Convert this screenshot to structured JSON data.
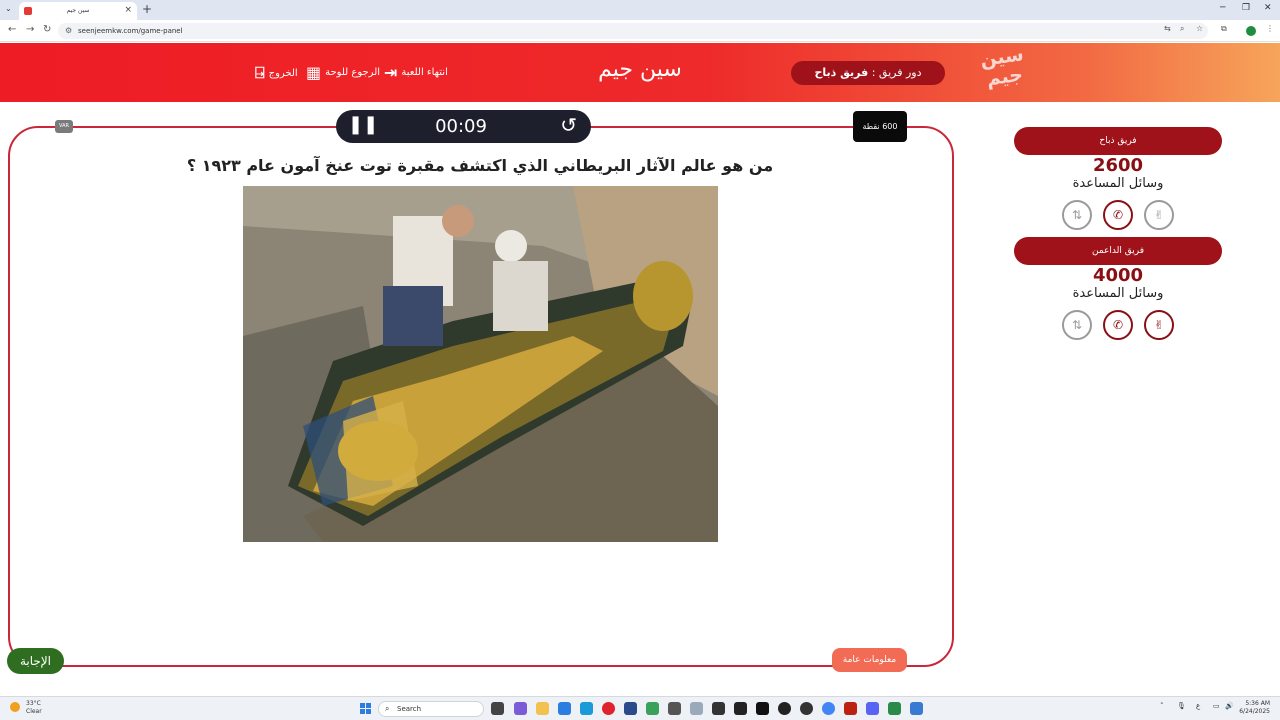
{
  "browser": {
    "tab_title": "سين جيم",
    "url": "seenjeemkw.com/game-panel",
    "new_tab": "+",
    "tab_close": "×",
    "minimize": "─",
    "restore": "❐",
    "close": "✕"
  },
  "header": {
    "app_title": "سين جيم",
    "logo_text_top": "سين",
    "logo_text_bottom": "جيم",
    "turn_prefix": "دور فريق : ",
    "turn_team": "فريق ذباح",
    "links": {
      "end_game": "انتهاء اللعبة",
      "back_board": "الرجوع للوحة",
      "exit": "الخروج"
    }
  },
  "question": {
    "timer": "00:09",
    "points": "600 نقطة",
    "text": "من هو عالم الآثار البريطاني الذي اكتشف مقبرة توت عنخ آمون عام ١٩٢٣ ؟",
    "category": "معلومات عامة",
    "answer_button": "الإجابة",
    "var_badge": "VAR"
  },
  "teams": [
    {
      "name": "فريق ذباح",
      "score": "2600",
      "helps_label": "وسائل المساعدة"
    },
    {
      "name": "فريق الداعمن",
      "score": "4000",
      "helps_label": "وسائل المساعدة"
    }
  ],
  "taskbar": {
    "temperature": "33°C",
    "condition": "Clear",
    "search_placeholder": "Search",
    "time": "5:36 AM",
    "date": "6/24/2025"
  },
  "colors": {
    "header_red": "#ee1c25",
    "header_orange": "#f6a55b",
    "team_pill": "#a0121a",
    "frame_border": "#c8283a",
    "answer_green": "#2f6e20",
    "category_orange": "#f26b55"
  }
}
